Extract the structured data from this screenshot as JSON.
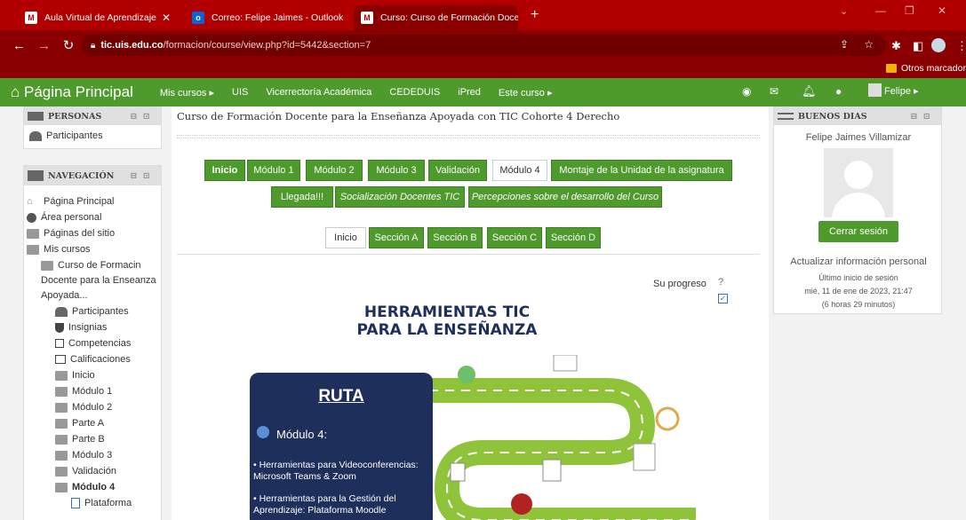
{
  "browser": {
    "tabs": [
      {
        "title": "Aula Virtual de Aprendizaje"
      },
      {
        "title": "Correo: Felipe Jaimes - Outlook"
      },
      {
        "title": "Curso: Curso de Formación Doce"
      }
    ],
    "url_host": "tic.uis.edu.co",
    "url_path": "/formacion/course/view.php?id=5442&section=7",
    "bookmark": "Otros marcadores"
  },
  "navbar": {
    "home": "Página Principal",
    "items": [
      "Mis cursos ▸",
      "UIS",
      "Vicerrectoría Académica",
      "CEDEDUIS",
      "iPred",
      "Este curso ▸"
    ],
    "user": "Felipe ▸"
  },
  "personas": {
    "title": "PERSONAS",
    "item": "Participantes"
  },
  "navegacion": {
    "title": "NAVEGACIÓN",
    "items": [
      "Página Principal",
      "Área personal",
      "Páginas del sitio",
      "Mis cursos"
    ],
    "course_lines": [
      "Curso de Formacin",
      "Docente para la Enseanza",
      "Apoyada..."
    ],
    "course_items": [
      "Participantes",
      "Insignias",
      "Competencias",
      "Calificaciones",
      "Inicio",
      "Módulo 1",
      "Módulo 2",
      "Parte A",
      "Parte B",
      "Módulo 3",
      "Validación",
      "Módulo 4",
      "Plataforma"
    ]
  },
  "course": {
    "title": "Curso de Formación Docente para la Enseñanza Apoyada con TIC Cohorte 4 Derecho",
    "tabs_row1": [
      "Inicio",
      "Módulo 1",
      "Módulo 2",
      "Módulo 3",
      "Validación",
      "Módulo 4",
      "Montaje de la Unidad de la asignatura"
    ],
    "tabs_row2": [
      "Llegada!!!",
      "Socialización Docentes TIC",
      "Percepciones sobre el desarrollo del Curso"
    ],
    "subtabs": [
      "Inicio",
      "Sección A",
      "Sección B",
      "Sección C",
      "Sección D"
    ],
    "progress": "Su progreso"
  },
  "graphic": {
    "title1": "HERRAMIENTAS TIC",
    "title2": "PARA LA ENSEÑANZA",
    "ruta": "RUTA",
    "modulo": "Módulo 4:",
    "bullet1": "• Herramientas para Videoconferencias: Microsoft Teams & Zoom",
    "bullet2": "• Herramientas para la Gestión del Aprendizaje: Plataforma Moodle"
  },
  "user_block": {
    "title": "BUENOS DIAS",
    "name": "Felipe Jaimes Villamizar",
    "logout": "Cerrar sesión",
    "update": "Actualizar información personal",
    "last_login_label": "Último inicio de sesión",
    "last_login_date": "mié, 11 de ene de 2023, 21:47",
    "ago": "(6 horas 29 minutos)"
  },
  "colors": {
    "green": "#4e9a2c",
    "red": "#b20000",
    "navy": "#1f2f5c"
  }
}
